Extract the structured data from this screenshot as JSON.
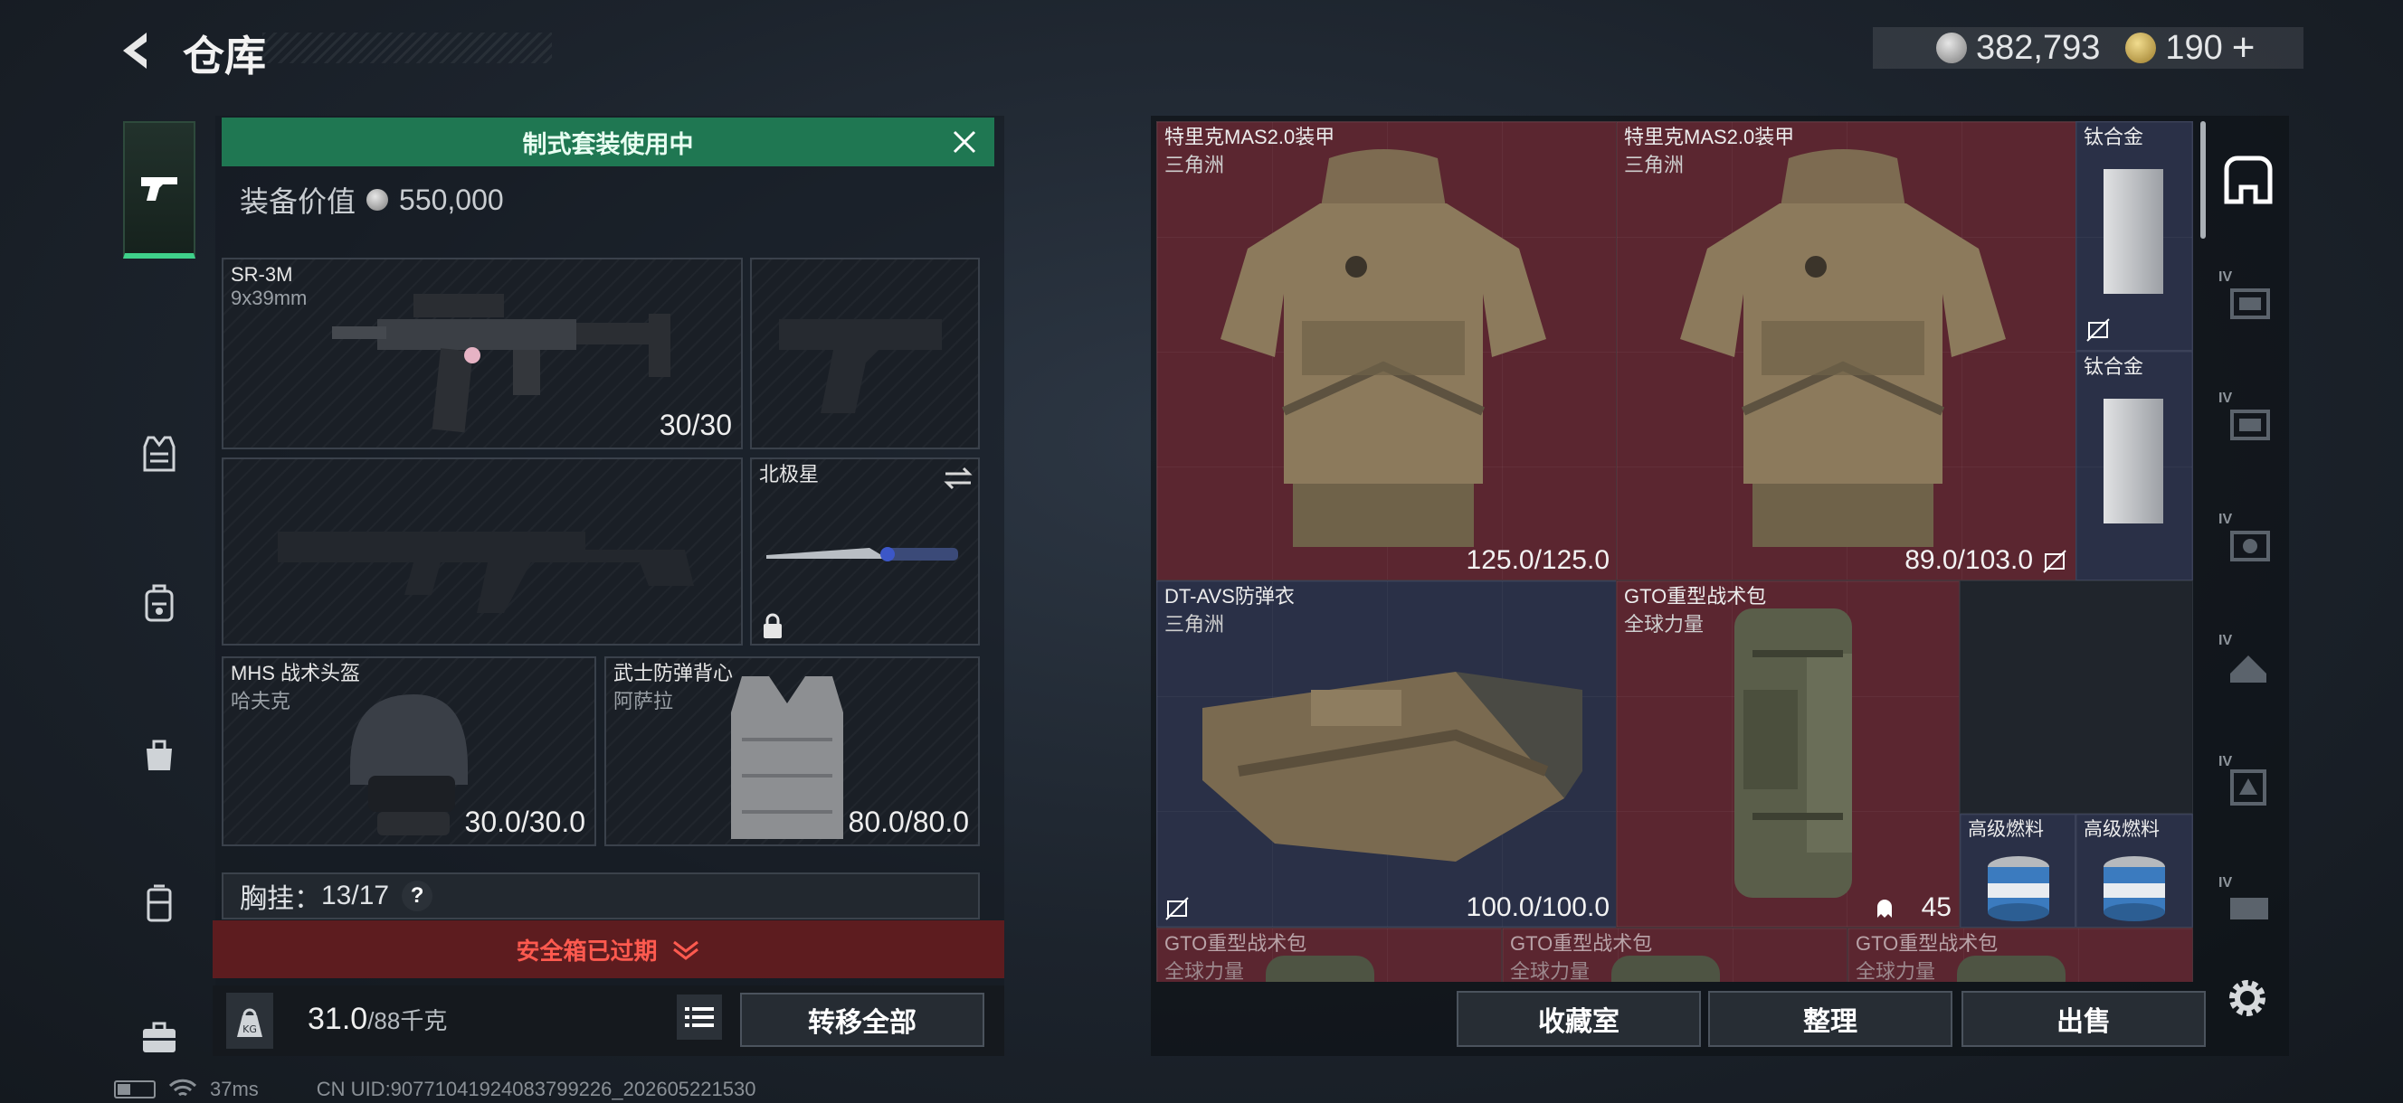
{
  "header": {
    "title": "仓库",
    "currency": {
      "silver": "382,793",
      "gold": "190",
      "add_label": "+"
    }
  },
  "left_nav": [
    "weapons-icon",
    "armor-icon",
    "backpack-icon",
    "bag-icon",
    "case-icon",
    "briefcase-icon"
  ],
  "loadout": {
    "banner": "制式套装使用中",
    "value_label": "装备价值",
    "value": "550,000",
    "primary": {
      "name": "SR-3M",
      "caliber": "9x39mm",
      "ammo": "30/30"
    },
    "melee": {
      "name": "北极星"
    },
    "helmet": {
      "name": "MHS 战术头盔",
      "brand": "哈夫克",
      "durability": "30.0/30.0"
    },
    "vest": {
      "name": "武士防弹背心",
      "brand": "阿萨拉",
      "durability": "80.0/80.0"
    },
    "chest_rig_label": "胸挂：",
    "chest_rig_value": "13/17",
    "chest_rig_help": "?",
    "safe_box": "安全箱已过期",
    "weight_value": "31.0",
    "weight_max": "/88千克",
    "weight_icon_label": "KG",
    "transfer_all": "转移全部"
  },
  "stash": {
    "items": {
      "armor1": {
        "name": "特里克MAS2.0装甲",
        "brand": "三角洲",
        "durability": "125.0/125.0"
      },
      "armor2": {
        "name": "特里克MAS2.0装甲",
        "brand": "三角洲",
        "durability": "89.0/103.0"
      },
      "titanium1": {
        "name": "钛合金"
      },
      "titanium2": {
        "name": "钛合金"
      },
      "vest3": {
        "name": "DT-AVS防弹衣",
        "brand": "三角洲",
        "durability": "100.0/100.0"
      },
      "backpack": {
        "name": "GTO重型战术包",
        "brand": "全球力量",
        "count": "45"
      },
      "fuel1": {
        "name": "高级燃料"
      },
      "fuel2": {
        "name": "高级燃料"
      },
      "bp_row1": {
        "name": "GTO重型战术包",
        "brand": "全球力量"
      },
      "bp_row2": {
        "name": "GTO重型战术包",
        "brand": "全球力量"
      },
      "bp_row3": {
        "name": "GTO重型战术包",
        "brand": "全球力量"
      }
    },
    "tabs": [
      {
        "icon": "stash-home-icon",
        "tier": ""
      },
      {
        "icon": "stash-tier-icon",
        "tier": "IV"
      },
      {
        "icon": "stash-tier-icon",
        "tier": "IV"
      },
      {
        "icon": "stash-tier-icon",
        "tier": "IV"
      },
      {
        "icon": "stash-tier-icon",
        "tier": "IV"
      },
      {
        "icon": "stash-tier-icon",
        "tier": "IV"
      },
      {
        "icon": "stash-tier-icon",
        "tier": "IV"
      }
    ],
    "buttons": {
      "collection": "收藏室",
      "organize": "整理",
      "sell": "出售"
    }
  },
  "status": {
    "ping": "37ms",
    "uid": "CN UID:90771041924083799226_202605221530"
  },
  "colors": {
    "accent_green": "#1f7752",
    "warning_red": "#ff5a4f",
    "item_red_bg": "#5b2630",
    "item_blue_bg": "#2a3047"
  }
}
